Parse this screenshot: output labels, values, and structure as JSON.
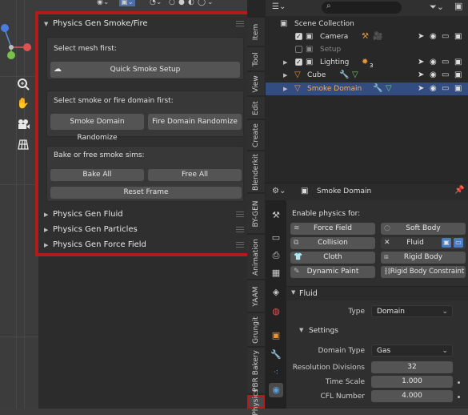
{
  "npanel": {
    "smoke_panel": {
      "title": "Physics Gen Smoke/Fire",
      "section1_label": "Select mesh first:",
      "quick_smoke_label": "Quick Smoke Setup",
      "section2_label": "Select smoke or fire domain first:",
      "smoke_randomize_label": "Smoke Domain Randomize",
      "fire_randomize_label": "Fire Domain Randomize",
      "section3_label": "Bake or free smoke sims:",
      "bake_all_label": "Bake All",
      "free_all_label": "Free All",
      "reset_frame_label": "Reset Frame"
    },
    "other_panels": [
      "Physics Gen Fluid",
      "Physics Gen Particles",
      "Physics Gen Force Field"
    ]
  },
  "side_tabs": [
    "Item",
    "Tool",
    "View",
    "Edit",
    "Create",
    "Blenderkit",
    "BY-GEN",
    "Animation",
    "YAAM",
    "Grungit",
    "PBR Bakery",
    "Physics"
  ],
  "outliner": {
    "rows": [
      {
        "label": "Scene Collection"
      },
      {
        "label": "Camera"
      },
      {
        "label": "Setup"
      },
      {
        "label": "Lighting",
        "badge": "3"
      },
      {
        "label": "Cube"
      },
      {
        "label": "Smoke Domain"
      }
    ]
  },
  "properties": {
    "object_name": "Smoke Domain",
    "enable_physics_label": "Enable physics for:",
    "physics_buttons": [
      "Force Field",
      "Soft Body",
      "Collision",
      "Fluid",
      "Cloth",
      "Rigid Body",
      "Dynamic Paint",
      "Rigid Body Constraint"
    ],
    "fluid_header": "Fluid",
    "type_label": "Type",
    "type_value": "Domain",
    "settings_header": "Settings",
    "domain_type_label": "Domain Type",
    "domain_type_value": "Gas",
    "resolution_label": "Resolution Divisions",
    "resolution_value": "32",
    "time_scale_label": "Time Scale",
    "time_scale_value": "1.000",
    "cfl_label": "CFL Number",
    "cfl_value": "4.000"
  },
  "colors": {
    "highlight_border": "#b31b1b",
    "selected_row": "#334d80",
    "accent_orange": "#e8953a",
    "accent_green": "#6fcf6f"
  }
}
